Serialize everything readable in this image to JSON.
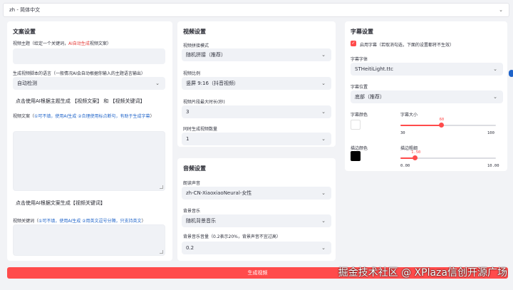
{
  "language": {
    "value": "zh - 简体中文"
  },
  "script": {
    "title": "文案设置",
    "subject_label_pre": "视频主题（给定一个关键词，",
    "subject_label_red": "AI自动生成",
    "subject_label_post": "视频文案）",
    "lang_label": "生成视频脚本的语言（一般情况AI会自动根据你输入的主题语言输出）",
    "lang_value": "自动检测",
    "btn_generate_script": "点击使用AI根据主题生成 【视频文案】 和 【视频关键词】",
    "script_label": "视频文案（",
    "script_hint": "①可不填，使用AI生成 ②合理使用标点断句，有助于生成字幕",
    "script_hint_close": "）",
    "btn_generate_terms": "点击使用AI根据文案生成【视频关键词】",
    "terms_label": "视频关键词（",
    "terms_hint": "①可不填，使用AI生成 ②用英文逗号分隔，只支持英文",
    "terms_hint_close": "）"
  },
  "video": {
    "title": "视频设置",
    "concat_label": "视频拼接模式",
    "concat_value": "随机拼接（推荐）",
    "ratio_label": "视频比例",
    "ratio_value": "竖屏 9:16（抖音视频）",
    "clip_label": "视频片段最大时长(秒)",
    "clip_value": "3",
    "count_label": "同时生成视频数量",
    "count_value": "1"
  },
  "audio": {
    "title": "音频设置",
    "voice_label": "朗读声音",
    "voice_value": "zh-CN-XiaoxiaoNeural-女性",
    "bgm_label": "背景音乐",
    "bgm_value": "随机背景音乐",
    "volume_label": "背景音乐音量（0.2表示20%，背景声音不宜过高）",
    "volume_value": "0.2"
  },
  "subtitle": {
    "title": "字幕设置",
    "enable_label": "启用字幕（若取消勾选，下面的设置都将不生效）",
    "font_label": "字幕字体",
    "font_value": "STHeitiLight.ttc",
    "position_label": "字幕位置",
    "position_value": "底部（推荐）",
    "color_label": "字幕颜色",
    "font_size_label": "字幕大小",
    "font_size": {
      "value": "60",
      "min": "30",
      "max": "100",
      "fraction": 0.43
    },
    "stroke_color_label": "描边颜色",
    "stroke_width_label": "描边粗细",
    "stroke_width": {
      "value": "1.50",
      "min": "0.00",
      "max": "10.00",
      "fraction": 0.15
    },
    "font_color": "#ffffff",
    "stroke_color": "#000000"
  },
  "submit_label": "生成视频",
  "watermark": "掘金技术社区 @ XPlaza信创开源广场",
  "colors": {
    "accent": "#ff4b4b",
    "link": "#1e63c9",
    "panel": "#ffffff",
    "field": "#f0f2f6"
  }
}
